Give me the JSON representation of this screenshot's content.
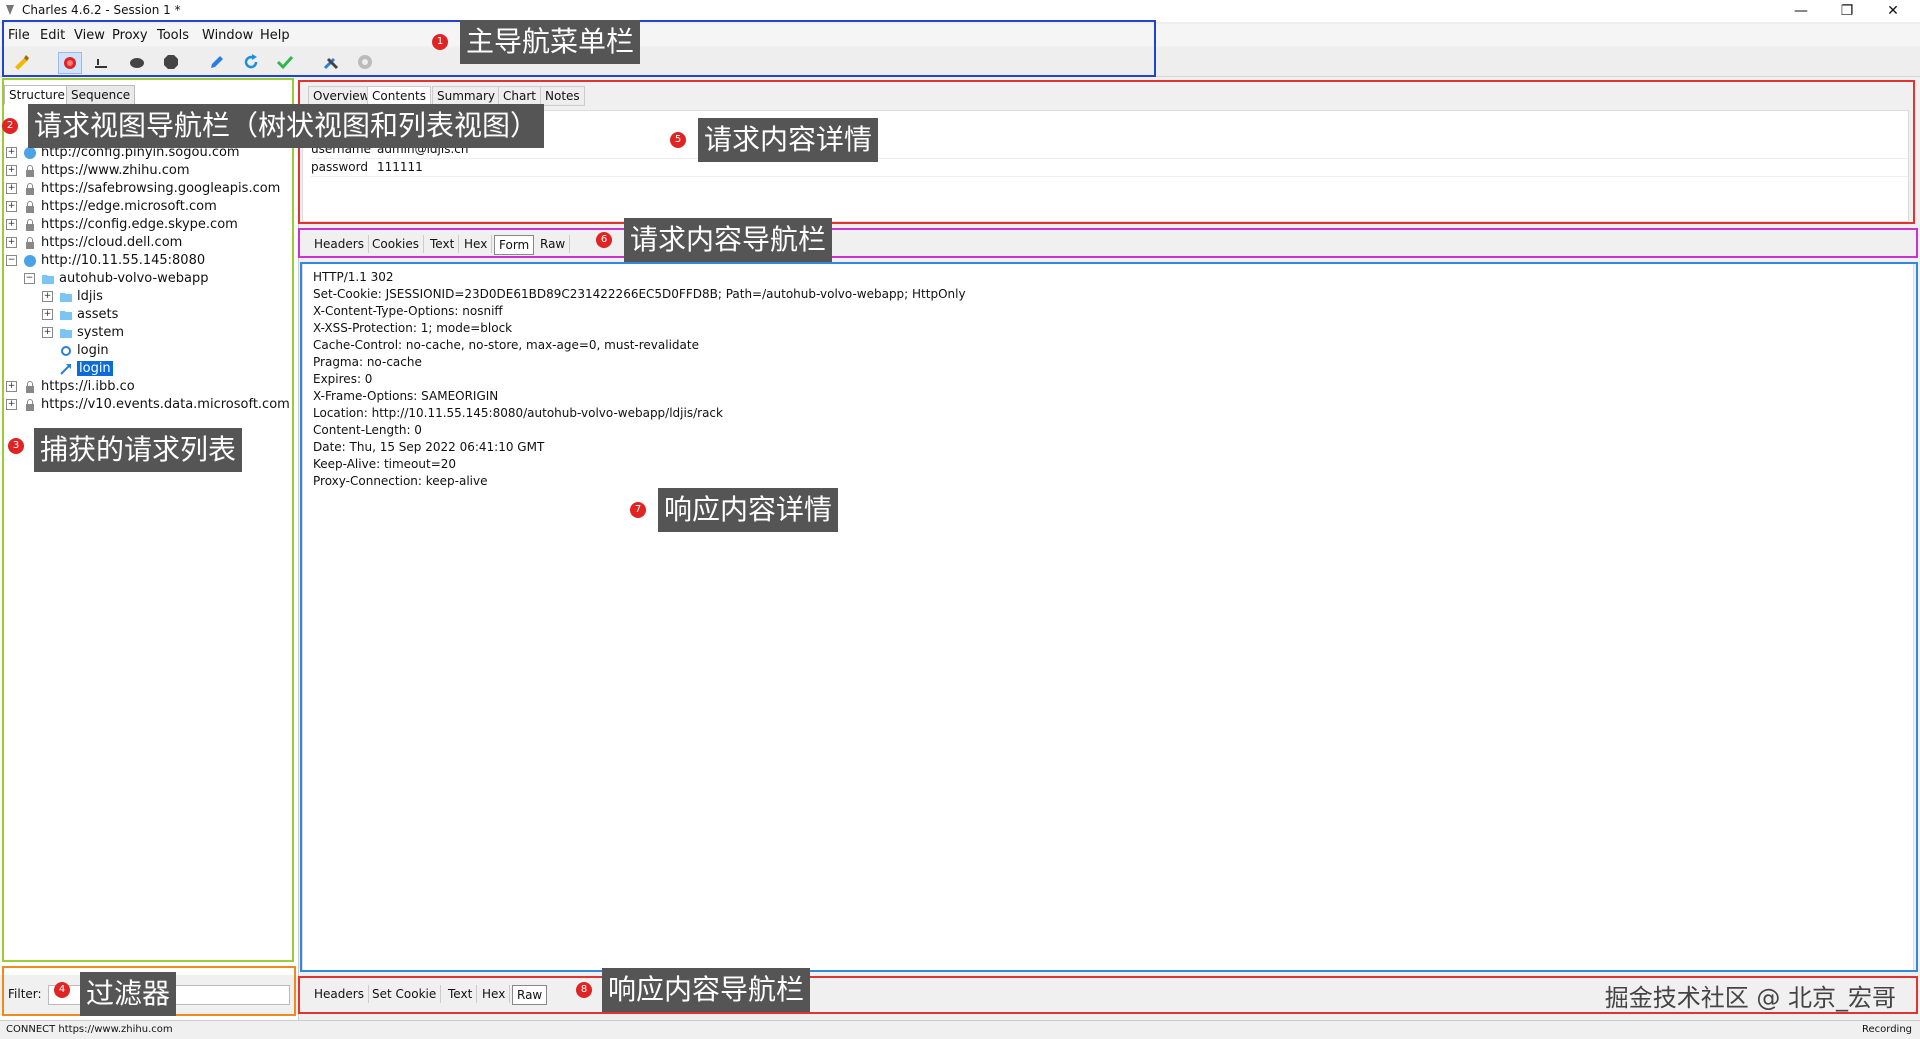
{
  "window": {
    "title": "Charles 4.6.2 - Session 1 *"
  },
  "menubar": [
    {
      "label": "File",
      "accel": "F"
    },
    {
      "label": "Edit",
      "accel": "E"
    },
    {
      "label": "View",
      "accel": "V"
    },
    {
      "label": "Proxy",
      "accel": "P"
    },
    {
      "label": "Tools",
      "accel": "T"
    },
    {
      "label": "Window",
      "accel": "W"
    },
    {
      "label": "Help",
      "accel": "H"
    }
  ],
  "toolbar": [
    {
      "name": "clear-icon"
    },
    {
      "name": "record-icon"
    },
    {
      "name": "throttle-icon"
    },
    {
      "name": "turtle-icon"
    },
    {
      "name": "stop-icon"
    },
    {
      "name": "compose-icon"
    },
    {
      "name": "repeat-icon"
    },
    {
      "name": "validate-icon"
    },
    {
      "name": "tools-icon"
    },
    {
      "name": "settings-icon"
    }
  ],
  "left": {
    "tabs": [
      "Structure",
      "Sequence"
    ],
    "tree": [
      {
        "label": "http://config.pinyin.sogou.com",
        "level": 0
      },
      {
        "label": "https://www.zhihu.com",
        "level": 0
      },
      {
        "label": "https://safebrowsing.googleapis.com",
        "level": 0
      },
      {
        "label": "https://edge.microsoft.com",
        "level": 0
      },
      {
        "label": "https://config.edge.skype.com",
        "level": 0
      },
      {
        "label": "https://cloud.dell.com",
        "level": 0
      },
      {
        "label": "http://10.11.55.145:8080",
        "level": 0,
        "expanded": true
      },
      {
        "label": "autohub-volvo-webapp",
        "level": 1,
        "expanded": true
      },
      {
        "label": "ldjis",
        "level": 2
      },
      {
        "label": "assets",
        "level": 2
      },
      {
        "label": "system",
        "level": 2
      },
      {
        "label": "login",
        "level": 3
      },
      {
        "label": "login",
        "level": 3,
        "selected": true
      },
      {
        "label": "https://i.ibb.co",
        "level": 0
      },
      {
        "label": "https://v10.events.data.microsoft.com",
        "level": 0
      }
    ],
    "filter_label": "Filter:"
  },
  "request": {
    "tabs": [
      "Overview",
      "Contents",
      "Summary",
      "Chart",
      "Notes"
    ],
    "form": [
      {
        "key": "username",
        "value": "admin@ldjis.cn"
      },
      {
        "key": "password",
        "value": "111111"
      }
    ],
    "nav": [
      "Headers",
      "Cookies",
      "Text",
      "Hex",
      "Form",
      "Raw"
    ]
  },
  "response": {
    "lines": [
      "HTTP/1.1 302",
      "Set-Cookie: JSESSIONID=23D0DE61BD89C231422266EC5D0FFD8B; Path=/autohub-volvo-webapp; HttpOnly",
      "X-Content-Type-Options: nosniff",
      "X-XSS-Protection: 1; mode=block",
      "Cache-Control: no-cache, no-store, max-age=0, must-revalidate",
      "Pragma: no-cache",
      "Expires: 0",
      "X-Frame-Options: SAMEORIGIN",
      "Location: http://10.11.55.145:8080/autohub-volvo-webapp/ldjis/rack",
      "Content-Length: 0",
      "Date: Thu, 15 Sep 2022 06:41:10 GMT",
      "Keep-Alive: timeout=20",
      "Proxy-Connection: keep-alive"
    ],
    "nav": [
      "Headers",
      "Set Cookie",
      "Text",
      "Hex",
      "Raw"
    ]
  },
  "status": {
    "left": "CONNECT https://www.zhihu.com",
    "right": "Recording"
  },
  "annotations": [
    {
      "num": "1",
      "label": "主导航菜单栏"
    },
    {
      "num": "2",
      "label": "请求视图导航栏（树状视图和列表视图）"
    },
    {
      "num": "3",
      "label": "捕获的请求列表"
    },
    {
      "num": "4",
      "label": "过滤器"
    },
    {
      "num": "5",
      "label": "请求内容详情"
    },
    {
      "num": "6",
      "label": "请求内容导航栏"
    },
    {
      "num": "7",
      "label": "响应内容详情"
    },
    {
      "num": "8",
      "label": "响应内容导航栏"
    }
  ],
  "watermark": "掘金技术社区 @ 北京_宏哥",
  "colors": {
    "selected": "#0a6cd8",
    "badge": "#e02424",
    "callout_bg": "#555555"
  }
}
